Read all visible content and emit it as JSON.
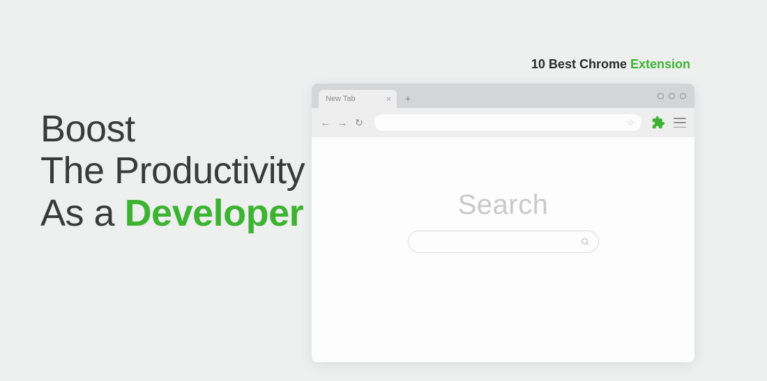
{
  "heading": {
    "prefix": "10 Best Chrome ",
    "accent": "Extension"
  },
  "hero": {
    "line1": "Boost",
    "line2": "The Productivity",
    "line3_prefix": "As a ",
    "line3_accent": "Developer"
  },
  "browser": {
    "tab_label": "New Tab",
    "tab_close": "×",
    "new_tab": "+",
    "nav_back": "←",
    "nav_forward": "→",
    "reload": "↻",
    "star": "☆",
    "search_label": "Search"
  },
  "colors": {
    "accent": "#3db332",
    "bg": "#eeefef"
  }
}
